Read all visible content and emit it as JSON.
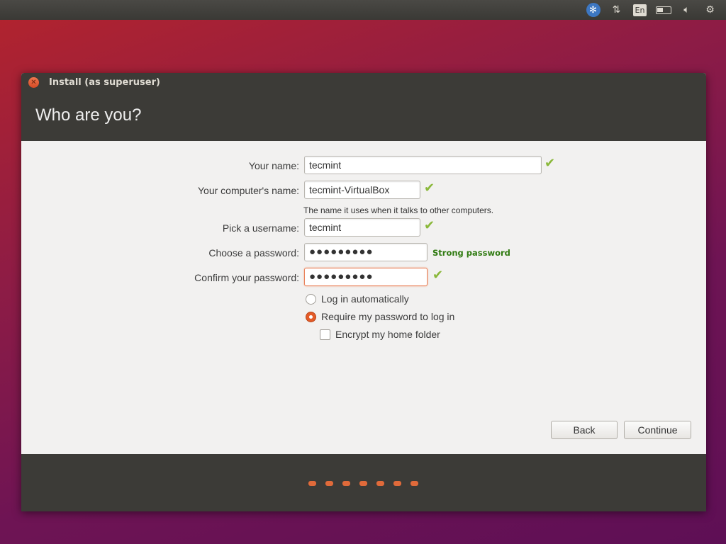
{
  "panel": {
    "icons": [
      "accessibility-icon",
      "network-icon",
      "keyboard-layout-icon",
      "battery-icon",
      "volume-icon",
      "power-gear-icon"
    ],
    "keyboard_layout": "En"
  },
  "window": {
    "title": "Install (as superuser)",
    "heading": "Who are you?"
  },
  "form": {
    "name": {
      "label": "Your name:",
      "value": "tecmint"
    },
    "computer": {
      "label": "Your computer's name:",
      "value": "tecmint-VirtualBox",
      "hint": "The name it uses when it talks to other computers."
    },
    "username": {
      "label": "Pick a username:",
      "value": "tecmint"
    },
    "password": {
      "label": "Choose a password:",
      "value": "●●●●●●●●●",
      "strength": "Strong password"
    },
    "confirm": {
      "label": "Confirm your password:",
      "value": "●●●●●●●●●"
    },
    "login_auto": {
      "label": "Log in automatically",
      "selected": false
    },
    "login_password": {
      "label": "Require my password to log in",
      "selected": true
    },
    "encrypt": {
      "label": "Encrypt my home folder",
      "checked": false
    }
  },
  "buttons": {
    "back": "Back",
    "continue": "Continue"
  },
  "progress": {
    "total_steps": 7
  },
  "colors": {
    "accent": "#e45b28",
    "valid": "#8ab83a",
    "strong": "#2f7a10"
  }
}
